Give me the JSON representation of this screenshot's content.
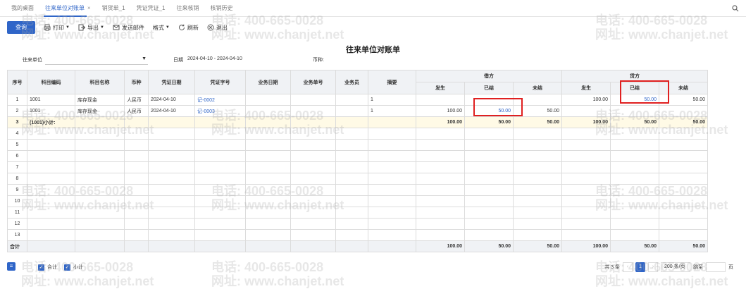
{
  "tabs": [
    {
      "label": "我的桌面",
      "closable": false
    },
    {
      "label": "往来单位对账单",
      "closable": true,
      "active": true
    },
    {
      "label": "销货单_1",
      "closable": false
    },
    {
      "label": "凭证凭证_1",
      "closable": false
    },
    {
      "label": "往来核销",
      "closable": false
    },
    {
      "label": "核销历史",
      "closable": false
    }
  ],
  "tab_close_glyph": "×",
  "toolbar": {
    "query": "查询",
    "print": "打印",
    "export": "导出",
    "send_email": "发送邮件",
    "format": "格式",
    "refresh": "刷新",
    "exit": "退出"
  },
  "title": "往来单位对账单",
  "filters": {
    "unit_label": "往来单位",
    "unit_value": "",
    "date_label": "日期",
    "date_value": "2024-04-10 - 2024-04-10",
    "currency_label": "币种:"
  },
  "table": {
    "headers": {
      "seq": "序号",
      "subject_code": "科目编码",
      "subject_name": "科目名称",
      "currency": "币种",
      "voucher_date": "凭证日期",
      "voucher_no": "凭证字号",
      "biz_date": "业务日期",
      "biz_no": "业务单号",
      "salesman": "业务员",
      "summary": "摘要",
      "debit": "借方",
      "credit": "贷方",
      "occur": "发生",
      "settled": "已结",
      "unsettled": "未结"
    },
    "rows": [
      {
        "seq": "1",
        "code": "1001",
        "name": "库存现金",
        "cur": "人民币",
        "vdate": "2024-04-10",
        "vno": "记-0002",
        "bdate": "",
        "bno": "",
        "sales": "",
        "summary": "1",
        "d_occur": "",
        "d_settled": "",
        "d_unsettled": "",
        "c_occur": "100.00",
        "c_settled": "50.00",
        "c_unsettled": "50.00"
      },
      {
        "seq": "2",
        "code": "1001",
        "name": "库存现金",
        "cur": "人民币",
        "vdate": "2024-04-10",
        "vno": "记-0003",
        "bdate": "",
        "bno": "",
        "sales": "",
        "summary": "1",
        "d_occur": "100.00",
        "d_settled": "50.00",
        "d_unsettled": "50.00",
        "c_occur": "",
        "c_settled": "",
        "c_unsettled": ""
      },
      {
        "seq": "3",
        "code": "(1001)小计:",
        "name": "",
        "cur": "",
        "vdate": "",
        "vno": "",
        "bdate": "",
        "bno": "",
        "sales": "",
        "summary": "",
        "d_occur": "100.00",
        "d_settled": "50.00",
        "d_unsettled": "50.00",
        "c_occur": "100.00",
        "c_settled": "50.00",
        "c_unsettled": "50.00"
      }
    ],
    "empty_seqs": [
      "4",
      "5",
      "6",
      "7",
      "8",
      "9",
      "10",
      "11",
      "12",
      "13"
    ],
    "total": {
      "label": "合计",
      "d_occur": "100.00",
      "d_settled": "50.00",
      "d_unsettled": "50.00",
      "c_occur": "100.00",
      "c_settled": "50.00",
      "c_unsettled": "50.00"
    }
  },
  "footer": {
    "menu_icon": "≡",
    "chk_total": "合计",
    "chk_subtotal": "小计",
    "record_count": "共 3 条",
    "current_page": "1",
    "page_size": "200 条/页",
    "goto_label": "跳至",
    "page_unit": "页",
    "prev": "‹",
    "next": "›"
  },
  "watermark": {
    "phone": "电话: 400-665-0028",
    "site": "网址: www.chanjet.net"
  },
  "colors": {
    "accent": "#2f65c8",
    "highlight": "#e02020",
    "subtotal_bg": "#fffae6"
  }
}
